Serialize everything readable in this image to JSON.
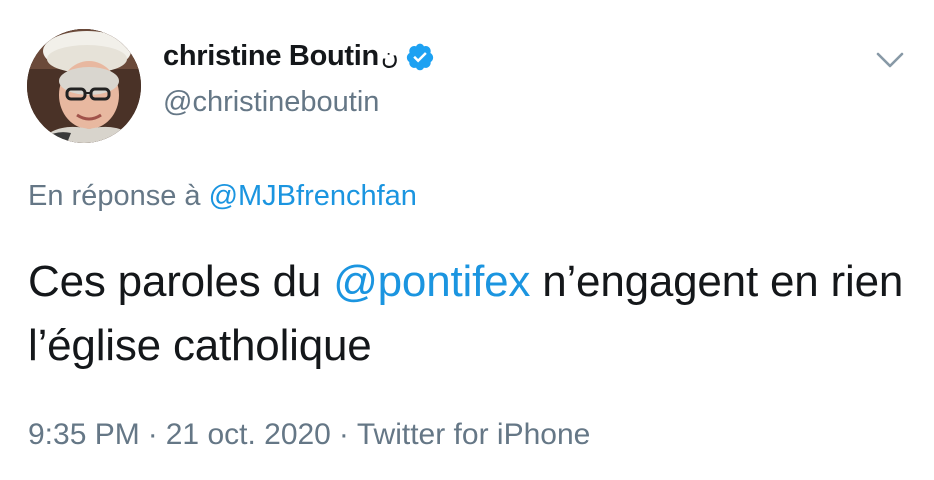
{
  "user": {
    "display_name": "christine Boutin",
    "name_emoji": "ن",
    "handle": "@christineboutin",
    "verified": true
  },
  "reply": {
    "prefix": "En réponse à",
    "mention": "@MJBfrenchfan"
  },
  "tweet": {
    "text_before": "Ces paroles du ",
    "mention": "@pontifex",
    "text_after": " n’engagent en rien l’église catholique"
  },
  "meta": {
    "time": "9:35 PM",
    "separator": "·",
    "date": "21 oct. 2020",
    "source": "Twitter for iPhone"
  },
  "icons": {
    "verified": "verified-badge-icon",
    "caret": "chevron-down-icon"
  },
  "colors": {
    "link": "#1b95e0",
    "secondary_text": "#657786",
    "primary_text": "#14171a",
    "verified": "#1da1f2"
  }
}
